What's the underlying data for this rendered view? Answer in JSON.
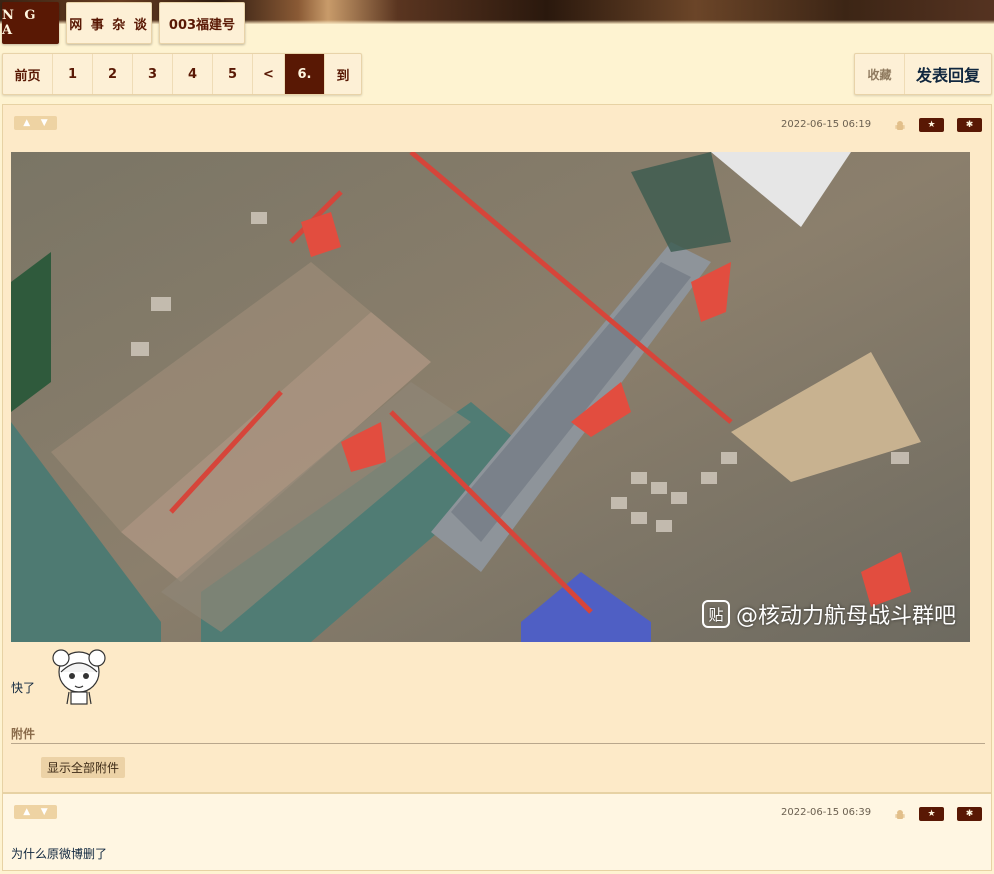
{
  "header": {
    "logo": "N G A",
    "breadcrumbs": [
      "网 事 杂 谈",
      "003福建号"
    ]
  },
  "pager": {
    "prev_label": "前页",
    "pages": [
      "1",
      "2",
      "3",
      "4",
      "5"
    ],
    "back_label": "<",
    "current": "6.",
    "goto_label": "到"
  },
  "actions": {
    "favorite_label": "收藏",
    "reply_label": "发表回复"
  },
  "posts": [
    {
      "date": "2022-06-15 06:19",
      "image_watermark": "@核动力航母战斗群吧",
      "text": "快了",
      "attachments_title": "附件",
      "show_all_label": "显示全部附件"
    },
    {
      "date": "2022-06-15 06:39",
      "text": "为什么原微博删了"
    }
  ],
  "colors": {
    "brand": "#591804",
    "page_bg": "#fef3d1",
    "post_bg": "#fdeac8",
    "post_alt_bg": "#fff6e2"
  },
  "icons": [
    "thumbs-up-icon",
    "thumbs-down-icon",
    "android-icon",
    "star-icon",
    "gear-icon"
  ]
}
